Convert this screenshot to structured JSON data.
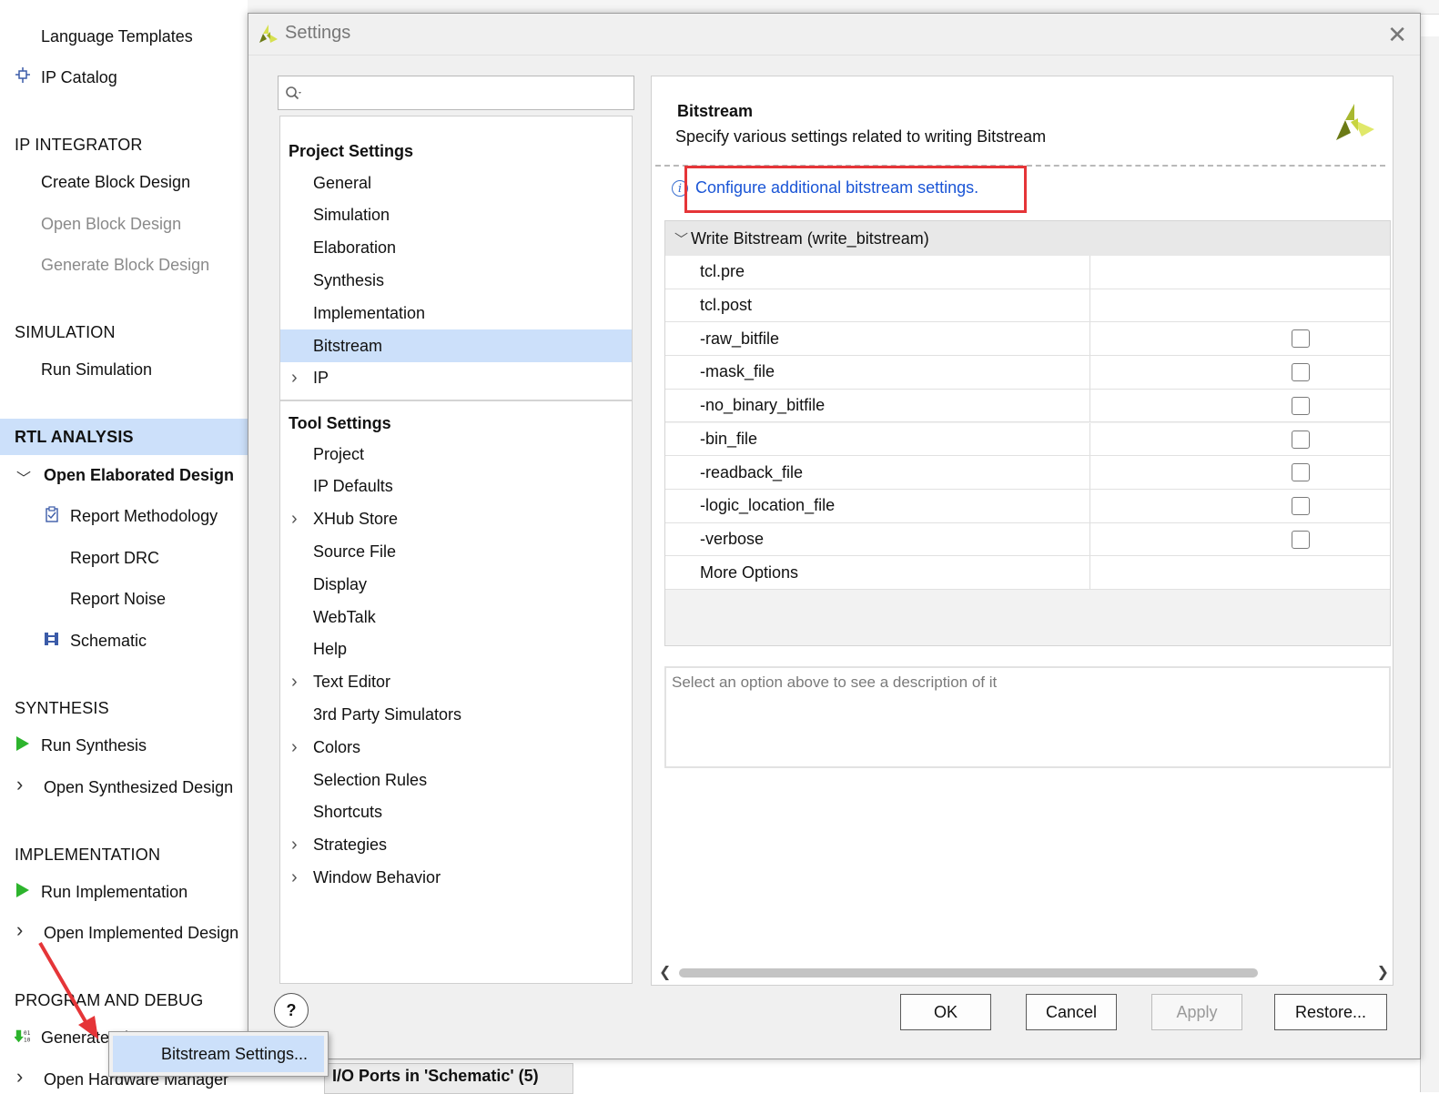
{
  "flow_navigator": {
    "items": [
      {
        "label": "Language Templates",
        "kind": "item"
      },
      {
        "label": "IP Catalog",
        "kind": "item",
        "icon": "ip-catalog-icon"
      },
      {
        "label": "IP INTEGRATOR",
        "kind": "section"
      },
      {
        "label": "Create Block Design",
        "kind": "item"
      },
      {
        "label": "Open Block Design",
        "kind": "item",
        "disabled": true
      },
      {
        "label": "Generate Block Design",
        "kind": "item",
        "disabled": true
      },
      {
        "label": "SIMULATION",
        "kind": "section"
      },
      {
        "label": "Run Simulation",
        "kind": "item"
      },
      {
        "label": "RTL ANALYSIS",
        "kind": "section",
        "active": true
      },
      {
        "label": "Open Elaborated Design",
        "kind": "expander",
        "expanded": true
      },
      {
        "label": "Report Methodology",
        "kind": "subitem",
        "icon": "clipboard-icon"
      },
      {
        "label": "Report DRC",
        "kind": "subitem"
      },
      {
        "label": "Report Noise",
        "kind": "subitem"
      },
      {
        "label": "Schematic",
        "kind": "subitem",
        "icon": "schematic-icon"
      },
      {
        "label": "SYNTHESIS",
        "kind": "section"
      },
      {
        "label": "Run Synthesis",
        "kind": "item",
        "icon": "run-icon"
      },
      {
        "label": "Open Synthesized Design",
        "kind": "expander"
      },
      {
        "label": "IMPLEMENTATION",
        "kind": "section"
      },
      {
        "label": "Run Implementation",
        "kind": "item",
        "icon": "run-icon"
      },
      {
        "label": "Open Implemented Design",
        "kind": "expander"
      },
      {
        "label": "PROGRAM AND DEBUG",
        "kind": "section"
      },
      {
        "label": "Generate Bitstream",
        "kind": "item",
        "icon": "bitstream-icon"
      },
      {
        "label": "Open Hardware Manager",
        "kind": "expander"
      }
    ]
  },
  "background": {
    "bottom_tab_label": "I/O Ports in 'Schematic' (5)"
  },
  "dialog": {
    "title": "Settings",
    "close_label": "✕",
    "search_placeholder": "",
    "tree": {
      "project_section": "Project Settings",
      "project_items": [
        {
          "label": "General"
        },
        {
          "label": "Simulation"
        },
        {
          "label": "Elaboration"
        },
        {
          "label": "Synthesis"
        },
        {
          "label": "Implementation"
        },
        {
          "label": "Bitstream",
          "selected": true
        },
        {
          "label": "IP",
          "expandable": true
        }
      ],
      "tool_section": "Tool Settings",
      "tool_items": [
        {
          "label": "Project"
        },
        {
          "label": "IP Defaults"
        },
        {
          "label": "XHub Store",
          "expandable": true
        },
        {
          "label": "Source File"
        },
        {
          "label": "Display"
        },
        {
          "label": "WebTalk"
        },
        {
          "label": "Help"
        },
        {
          "label": "Text Editor",
          "expandable": true
        },
        {
          "label": "3rd Party Simulators"
        },
        {
          "label": "Colors",
          "expandable": true
        },
        {
          "label": "Selection Rules"
        },
        {
          "label": "Shortcuts"
        },
        {
          "label": "Strategies",
          "expandable": true
        },
        {
          "label": "Window Behavior",
          "expandable": true
        }
      ]
    },
    "content": {
      "title": "Bitstream",
      "description": "Specify various settings related to writing Bitstream",
      "config_link": "Configure additional bitstream settings.",
      "group_label": "Write Bitstream (write_bitstream)",
      "options": [
        {
          "name": "tcl.pre",
          "type": "text",
          "value": ""
        },
        {
          "name": "tcl.post",
          "type": "text",
          "value": ""
        },
        {
          "name": "-raw_bitfile",
          "type": "checkbox",
          "checked": false
        },
        {
          "name": "-mask_file",
          "type": "checkbox",
          "checked": false
        },
        {
          "name": "-no_binary_bitfile",
          "type": "checkbox",
          "checked": false
        },
        {
          "name": "-bin_file",
          "type": "checkbox",
          "checked": false
        },
        {
          "name": "-readback_file",
          "type": "checkbox",
          "checked": false
        },
        {
          "name": "-logic_location_file",
          "type": "checkbox",
          "checked": false
        },
        {
          "name": "-verbose",
          "type": "checkbox",
          "checked": false
        },
        {
          "name": "More Options",
          "type": "text",
          "value": ""
        }
      ],
      "option_description_placeholder": "Select an option above to see a description of it"
    },
    "buttons": {
      "help": "?",
      "ok": "OK",
      "cancel": "Cancel",
      "apply": "Apply",
      "restore": "Restore..."
    }
  },
  "popup_menu": {
    "item": "Bitstream Settings..."
  },
  "colors": {
    "selection": "#cce0fa",
    "link": "#1a55d6",
    "highlight_box": "#e53538",
    "run_icon": "#2db42d",
    "xilinx_logo_dark": "#6b7a16",
    "xilinx_logo_light": "#d6e050"
  }
}
